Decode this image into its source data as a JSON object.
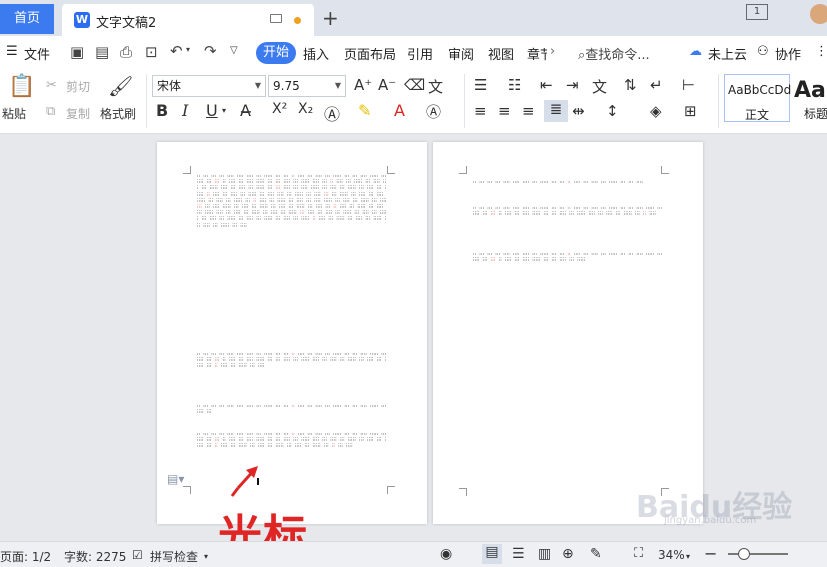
{
  "tabs": {
    "home": "首页",
    "document": "文字文稿2"
  },
  "menu": {
    "file": "文件",
    "start": "开始",
    "insert": "插入",
    "layout": "页面布局",
    "reference": "引用",
    "review": "审阅",
    "view": "视图",
    "chapter": "章节",
    "search": "查找命令...",
    "cloud": "未上云",
    "collab": "协作"
  },
  "toolbar": {
    "paste": "粘贴",
    "cut": "剪切",
    "copy": "复制",
    "format_painter": "格式刷",
    "font_name": "宋体",
    "font_size": "9.75",
    "bold": "B",
    "italic": "I",
    "underline": "U",
    "superscript": "X²",
    "subscript": "X₂"
  },
  "styles": {
    "normal_sample": "AaBbCcDd",
    "normal_label": "正文",
    "title_sample": "AaB",
    "title_label": "标题"
  },
  "annotation": "光标",
  "watermark": "Baidu经验",
  "watermark_sub": "jingyan.baidu.com",
  "status": {
    "page": "页面: 1/2",
    "words": "字数: 2275",
    "spell": "拼写检查",
    "zoom": "34%"
  },
  "colors": {
    "accent": "#3c7af0",
    "annotation": "#e02525"
  }
}
